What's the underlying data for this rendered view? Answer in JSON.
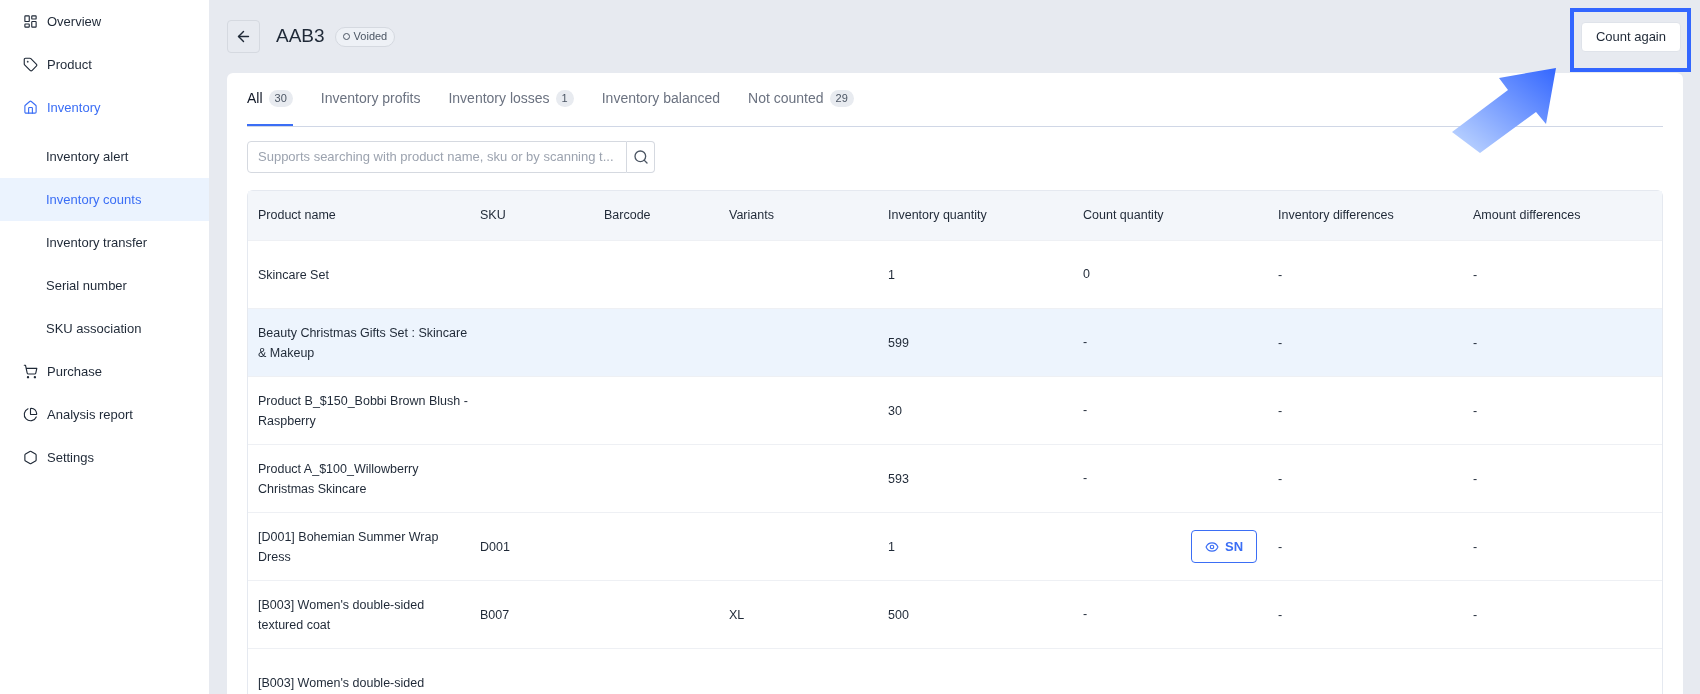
{
  "sidebar": {
    "items": [
      {
        "label": "Overview",
        "selected": false
      },
      {
        "label": "Product",
        "selected": false
      },
      {
        "label": "Inventory",
        "selected": true,
        "children": [
          {
            "label": "Inventory alert",
            "selected": false
          },
          {
            "label": "Inventory counts",
            "selected": true
          },
          {
            "label": "Inventory transfer",
            "selected": false
          },
          {
            "label": "Serial number",
            "selected": false
          },
          {
            "label": "SKU association",
            "selected": false
          }
        ]
      },
      {
        "label": "Purchase",
        "selected": false
      },
      {
        "label": "Analysis report",
        "selected": false
      },
      {
        "label": "Settings",
        "selected": false
      }
    ]
  },
  "header": {
    "title": "AAB3",
    "status": "Voided",
    "action": "Count again"
  },
  "tabs": [
    {
      "label": "All",
      "count": "30",
      "selected": true
    },
    {
      "label": "Inventory profits",
      "selected": false
    },
    {
      "label": "Inventory losses",
      "count": "1",
      "selected": false
    },
    {
      "label": "Inventory balanced",
      "selected": false
    },
    {
      "label": "Not counted",
      "count": "29",
      "selected": false
    }
  ],
  "search": {
    "placeholder": "Supports searching with product name, sku or by scanning t..."
  },
  "table": {
    "columns": [
      "Product name",
      "SKU",
      "Barcode",
      "Variants",
      "Inventory quantity",
      "Count quantity",
      "Inventory differences",
      "Amount differences"
    ],
    "rows": [
      {
        "highlighted": false,
        "product_name": "Skincare Set",
        "inventory_quantity": "1",
        "count_quantity": {
          "kind": "text",
          "text": "0"
        },
        "inventory_differences": "-",
        "amount_differences": "-"
      },
      {
        "highlighted": true,
        "product_name": "Beauty Christmas Gifts Set : Skincare & Makeup",
        "inventory_quantity": "599",
        "count_quantity": {
          "kind": "text",
          "text": "-"
        },
        "inventory_differences": "-",
        "amount_differences": "-"
      },
      {
        "highlighted": false,
        "product_name": "Product B_$150_Bobbi Brown Blush - Raspberry",
        "inventory_quantity": "30",
        "count_quantity": {
          "kind": "text",
          "text": "-"
        },
        "inventory_differences": "-",
        "amount_differences": "-"
      },
      {
        "highlighted": false,
        "product_name": "Product A_$100_Willowberry Christmas Skincare",
        "inventory_quantity": "593",
        "count_quantity": {
          "kind": "text",
          "text": "-"
        },
        "inventory_differences": "-",
        "amount_differences": "-"
      },
      {
        "highlighted": false,
        "product_name": "[D001] Bohemian Summer Wrap Dress",
        "sku": "D001",
        "inventory_quantity": "1",
        "count_quantity": {
          "kind": "button",
          "text": "SN"
        },
        "inventory_differences": "-",
        "amount_differences": "-"
      },
      {
        "highlighted": false,
        "product_name": "[B003] Women's double-sided textured coat",
        "sku": "B007",
        "variants": "XL",
        "inventory_quantity": "500",
        "count_quantity": {
          "kind": "text",
          "text": "-"
        },
        "inventory_differences": "-",
        "amount_differences": "-"
      },
      {
        "highlighted": false,
        "product_name": "[B003] Women's double-sided"
      }
    ]
  }
}
